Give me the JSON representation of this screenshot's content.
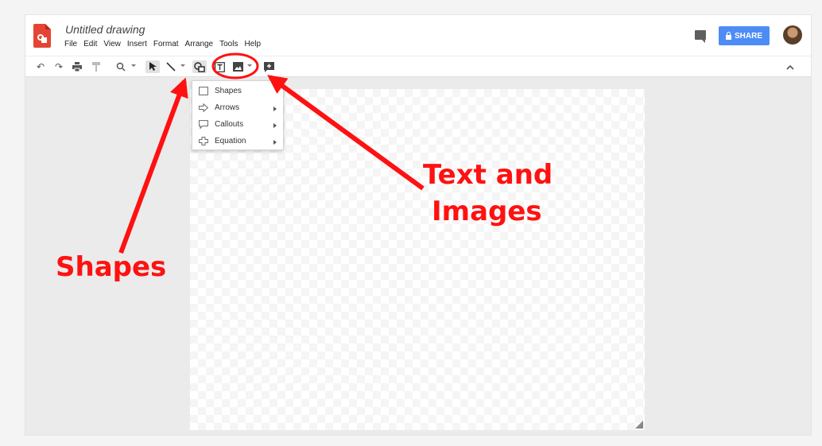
{
  "app": {
    "title": "Untitled drawing",
    "logo_icon": "google-drawings-logo-icon",
    "brand_color": "#e54435"
  },
  "menubar": [
    "File",
    "Edit",
    "View",
    "Insert",
    "Format",
    "Arrange",
    "Tools",
    "Help"
  ],
  "header": {
    "share_label": "SHARE",
    "share_color": "#4d8cf5",
    "comment_icon": "comment-icon",
    "avatar": "user-avatar"
  },
  "toolbar": {
    "icons": [
      "undo-icon",
      "redo-icon",
      "print-icon",
      "paint-format-icon",
      "zoom-icon",
      "select-icon",
      "line-icon",
      "shape-icon",
      "text-box-icon",
      "image-icon",
      "new-comment-icon",
      "collapse-icon"
    ]
  },
  "shape_menu": {
    "items": [
      {
        "label": "Shapes",
        "icon": "square-icon",
        "submenu": false
      },
      {
        "label": "Arrows",
        "icon": "arrow-outline-icon",
        "submenu": true
      },
      {
        "label": "Callouts",
        "icon": "callout-icon",
        "submenu": true
      },
      {
        "label": "Equation",
        "icon": "plus-outline-icon",
        "submenu": true
      }
    ]
  },
  "annotations": {
    "shapes_label": "Shapes",
    "text_images_line1": "Text and",
    "text_images_line2": "Images",
    "color": "#ff1111"
  }
}
